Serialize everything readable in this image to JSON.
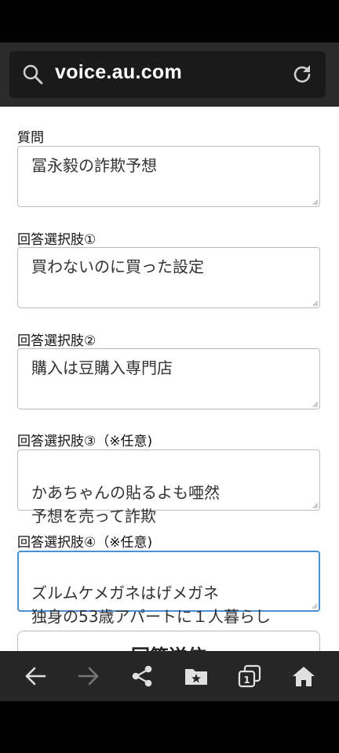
{
  "browser": {
    "url": "voice.au.com"
  },
  "form": {
    "fields": [
      {
        "label": "質問",
        "value": "冨永毅の詐欺予想"
      },
      {
        "label": "回答選択肢①",
        "value": "買わないのに買った設定"
      },
      {
        "label": "回答選択肢②",
        "value": "購入は豆購入専門店"
      },
      {
        "label": "回答選択肢③（※任意)",
        "value": "かあちゃんの貼るよも唖然\n予想を売って詐欺"
      },
      {
        "label": "回答選択肢④（※任意)",
        "value": "ズルムケメガネはげメガネ\n独身の53歳アパートに１人暮らし"
      }
    ],
    "submit_label": "回答送信"
  },
  "navbar": {
    "tab_count": "1"
  }
}
